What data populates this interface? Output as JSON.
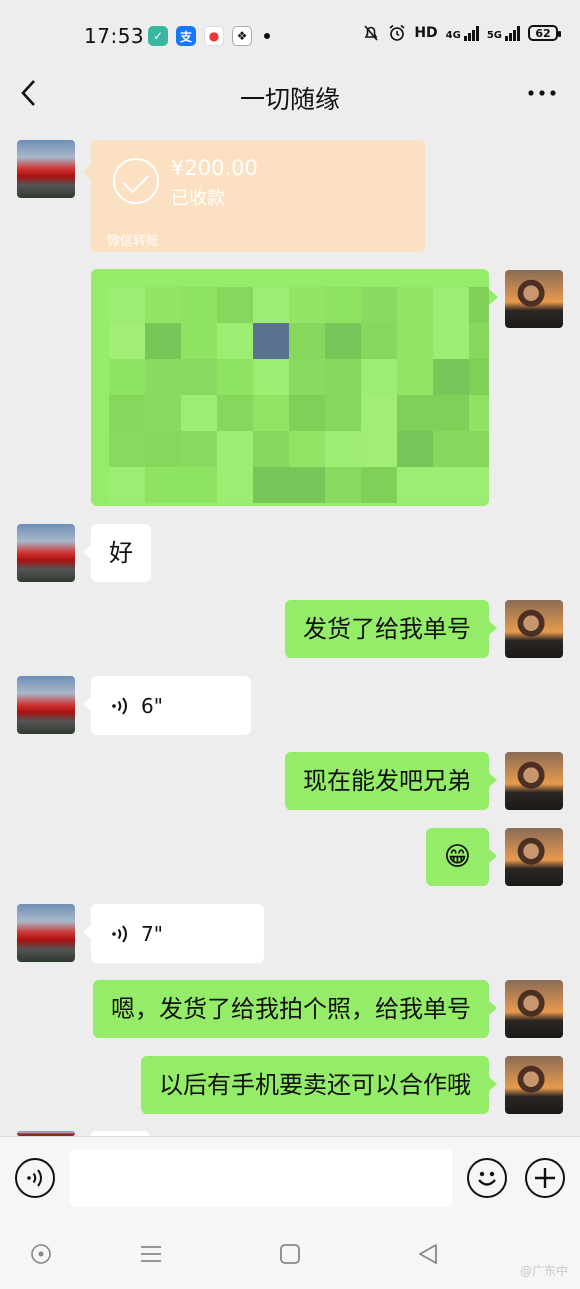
{
  "status_bar": {
    "time": "17:53",
    "app_icons": [
      "shield-app-icon",
      "alipay-icon",
      "map-pin-app-icon",
      "baidu-paw-icon"
    ],
    "hd_label": "HD",
    "network_4g": "4G",
    "network_5g": "5G",
    "battery": "62"
  },
  "header": {
    "title": "一切随缘"
  },
  "messages": {
    "transfer": {
      "amount": "¥200.00",
      "status": "已收款",
      "footer": "微信转账"
    },
    "m1": "好",
    "m2": "发货了给我单号",
    "m3_duration": "6\"",
    "m4": "现在能发吧兄弟",
    "m5_emoji": "😁",
    "m6_duration": "7\"",
    "m7": "嗯，发货了给我拍个照，给我单号",
    "m8": "以后有手机要卖还可以合作哦"
  },
  "input_bar": {
    "placeholder": ""
  },
  "watermark": "@广东中",
  "colors": {
    "bubble_green": "#95ec69",
    "bubble_white": "#ffffff",
    "transfer_orange": "#fbe1c2",
    "background": "#ededed"
  }
}
